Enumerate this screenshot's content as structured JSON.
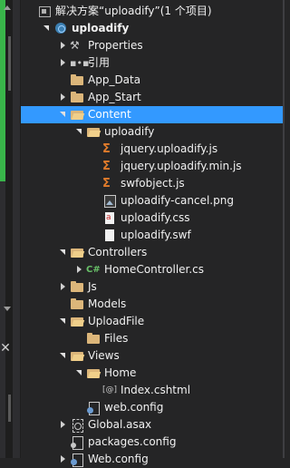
{
  "solution_label": "解决方案“uploadify”(1 个项目)",
  "tree": [
    {
      "level": 0,
      "expander": "none",
      "icon": "solution-icon",
      "label": "解决方案“uploadify”(1 个项目)",
      "bold": false
    },
    {
      "level": 1,
      "expander": "expanded",
      "icon": "web-project-icon",
      "label": "uploadify",
      "bold": true
    },
    {
      "level": 2,
      "expander": "collapsed",
      "icon": "wrench-icon",
      "label": "Properties"
    },
    {
      "level": 2,
      "expander": "collapsed",
      "icon": "references-icon",
      "label": "引用"
    },
    {
      "level": 2,
      "expander": "none",
      "icon": "folder-icon",
      "label": "App_Data"
    },
    {
      "level": 2,
      "expander": "collapsed",
      "icon": "folder-icon",
      "label": "App_Start"
    },
    {
      "level": 2,
      "expander": "expanded",
      "icon": "folder-open-icon",
      "label": "Content",
      "selected": true
    },
    {
      "level": 3,
      "expander": "expanded",
      "icon": "folder-open-icon",
      "label": "uploadify"
    },
    {
      "level": 4,
      "expander": "none",
      "icon": "js-file-icon",
      "label": "jquery.uploadify.js"
    },
    {
      "level": 4,
      "expander": "none",
      "icon": "js-file-icon",
      "label": "jquery.uploadify.min.js"
    },
    {
      "level": 4,
      "expander": "none",
      "icon": "js-file-icon",
      "label": "swfobject.js"
    },
    {
      "level": 4,
      "expander": "none",
      "icon": "image-file-icon",
      "label": "uploadify-cancel.png"
    },
    {
      "level": 4,
      "expander": "none",
      "icon": "css-file-icon",
      "label": "uploadify.css"
    },
    {
      "level": 4,
      "expander": "none",
      "icon": "generic-file-icon",
      "label": "uploadify.swf"
    },
    {
      "level": 2,
      "expander": "expanded",
      "icon": "folder-open-icon",
      "label": "Controllers"
    },
    {
      "level": 3,
      "expander": "collapsed",
      "icon": "csharp-file-icon",
      "label": "HomeController.cs"
    },
    {
      "level": 2,
      "expander": "collapsed",
      "icon": "folder-icon",
      "label": "Js"
    },
    {
      "level": 2,
      "expander": "none",
      "icon": "folder-icon",
      "label": "Models"
    },
    {
      "level": 2,
      "expander": "expanded",
      "icon": "folder-open-icon",
      "label": "UploadFile"
    },
    {
      "level": 3,
      "expander": "none",
      "icon": "folder-icon",
      "label": "Files"
    },
    {
      "level": 2,
      "expander": "expanded",
      "icon": "folder-open-icon",
      "label": "Views"
    },
    {
      "level": 3,
      "expander": "expanded",
      "icon": "folder-open-icon",
      "label": "Home"
    },
    {
      "level": 4,
      "expander": "none",
      "icon": "cshtml-file-icon",
      "label": "Index.cshtml"
    },
    {
      "level": 3,
      "expander": "none",
      "icon": "config-file-icon",
      "label": "web.config"
    },
    {
      "level": 2,
      "expander": "collapsed",
      "icon": "global-asax-icon",
      "label": "Global.asax"
    },
    {
      "level": 2,
      "expander": "none",
      "icon": "packages-config-icon",
      "label": "packages.config"
    },
    {
      "level": 2,
      "expander": "collapsed",
      "icon": "config-file-icon",
      "label": "Web.config"
    }
  ],
  "colors": {
    "background": "#252526",
    "selection": "#3399ff",
    "folder": "#dcb67a",
    "js": "#e07b2b",
    "accent_green": "#39b54a"
  },
  "icon_glyphs": {
    "wrench": "🔧",
    "references": "▪▪",
    "js": "Ѕ",
    "csharp": "C#",
    "cshtml": "[@]"
  }
}
